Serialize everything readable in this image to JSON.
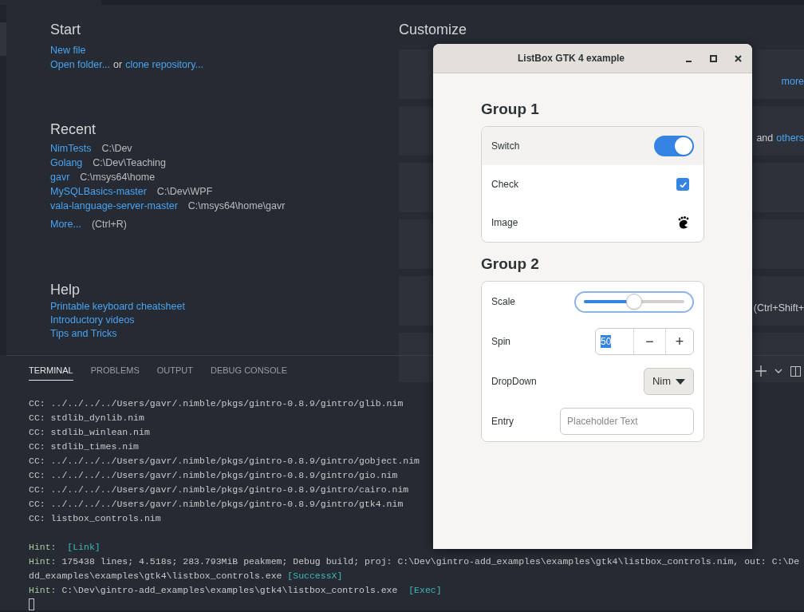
{
  "welcome": {
    "start": {
      "title": "Start",
      "items": [
        [
          {
            "text": "New file",
            "kind": "link"
          }
        ],
        [
          {
            "text": "Open folder...",
            "kind": "link"
          },
          {
            "text": "or",
            "kind": "plain"
          },
          {
            "text": "clone repository...",
            "kind": "link"
          }
        ]
      ]
    },
    "recent": {
      "title": "Recent",
      "items": [
        {
          "name": "NimTests",
          "path": "C:\\Dev"
        },
        {
          "name": "Golang",
          "path": "C:\\Dev\\Teaching"
        },
        {
          "name": "gavr",
          "path": "C:\\msys64\\home"
        },
        {
          "name": "MySQLBasics-master",
          "path": "C:\\Dev\\WPF"
        },
        {
          "name": "vala-language-server-master",
          "path": "C:\\msys64\\home\\gavr"
        }
      ],
      "more": {
        "label": "More...",
        "shortcut": "(Ctrl+R)"
      }
    },
    "help": {
      "title": "Help",
      "items": [
        "Printable keyboard cheatsheet",
        "Introductory videos",
        "Tips and Tricks"
      ]
    },
    "customize": {
      "title": "Customize",
      "cards": [
        {
          "kind": "text",
          "texts": [
            {
              "text": "more",
              "kind": "link"
            }
          ]
        },
        {
          "kind": "text",
          "texts": [
            {
              "text": "and",
              "kind": "plain"
            },
            {
              "text": "others",
              "kind": "link"
            }
          ]
        },
        {
          "kind": "blank"
        },
        {
          "kind": "blank"
        },
        {
          "kind": "text",
          "texts": [
            {
              "text": "(Ctrl+Shift+",
              "kind": "plain"
            }
          ]
        },
        {
          "kind": "blank"
        }
      ]
    }
  },
  "panel": {
    "tabs": [
      {
        "label": "TERMINAL",
        "selected": true
      },
      {
        "label": "PROBLEMS",
        "selected": false
      },
      {
        "label": "OUTPUT",
        "selected": false
      },
      {
        "label": "DEBUG CONSOLE",
        "selected": false
      }
    ],
    "lines": [
      [
        {
          "text": "CC: ../../../../Users/gavr/.nimble/pkgs/gintro-0.8.9/gintro/glib.nim",
          "kind": "plain"
        }
      ],
      [
        {
          "text": "CC: stdlib_dynlib.nim",
          "kind": "plain"
        }
      ],
      [
        {
          "text": "CC: stdlib_winlean.nim",
          "kind": "plain"
        }
      ],
      [
        {
          "text": "CC: stdlib_times.nim",
          "kind": "plain"
        }
      ],
      [
        {
          "text": "CC: ../../../../Users/gavr/.nimble/pkgs/gintro-0.8.9/gintro/gobject.nim",
          "kind": "plain"
        }
      ],
      [
        {
          "text": "CC: ../../../../Users/gavr/.nimble/pkgs/gintro-0.8.9/gintro/gio.nim",
          "kind": "plain"
        }
      ],
      [
        {
          "text": "CC: ../../../../Users/gavr/.nimble/pkgs/gintro-0.8.9/gintro/cairo.nim",
          "kind": "plain"
        }
      ],
      [
        {
          "text": "CC: ../../../../Users/gavr/.nimble/pkgs/gintro-0.8.9/gintro/gtk4.nim",
          "kind": "plain"
        }
      ],
      [
        {
          "text": "CC: listbox_controls.nim",
          "kind": "plain"
        }
      ],
      {
        "kind": "blank"
      },
      [
        {
          "text": "Hint:  ",
          "kind": "hint"
        },
        {
          "text": "[Link]",
          "kind": "tag"
        }
      ],
      [
        {
          "text": "Hint:",
          "kind": "hint"
        },
        {
          "text": " 175438 lines; 4.518s; 283.793MiB peakmem; Debug build; proj: C:\\Dev\\gintro-add_examples\\examples\\gtk4\\listbox_controls.nim, out: C:\\De",
          "kind": "plain"
        }
      ],
      [
        {
          "text": "dd_examples\\examples\\gtk4\\listbox_controls.exe ",
          "kind": "plain"
        },
        {
          "text": "[SuccessX]",
          "kind": "tag"
        }
      ],
      [
        {
          "text": "Hint:",
          "kind": "hint"
        },
        {
          "text": " C:\\Dev\\gintro-add_examples\\examples\\gtk4\\listbox_controls.exe  ",
          "kind": "plain"
        },
        {
          "text": "[Exec]",
          "kind": "tag"
        }
      ]
    ]
  },
  "gtk_window": {
    "title": "ListBox GTK 4 example",
    "groups": [
      {
        "title": "Group 1",
        "rows": [
          {
            "label": "Switch",
            "kind": "switch",
            "on": true,
            "highlighted": true
          },
          {
            "label": "Check",
            "kind": "check",
            "checked": true,
            "highlighted": false
          },
          {
            "label": "Image",
            "kind": "image",
            "highlighted": false
          }
        ]
      },
      {
        "title": "Group 2",
        "rows": [
          {
            "label": "Scale",
            "kind": "scale",
            "level": 0.5,
            "highlighted": false
          },
          {
            "label": "Spin",
            "kind": "spin",
            "value": "50",
            "minus": "−",
            "plus": "+",
            "highlighted": false
          },
          {
            "label": "DropDown",
            "kind": "dropdown",
            "value": "Nim",
            "highlighted": false
          },
          {
            "label": "Entry",
            "kind": "entry",
            "placeholder": "Placeholder Text",
            "highlighted": false
          }
        ]
      }
    ]
  }
}
